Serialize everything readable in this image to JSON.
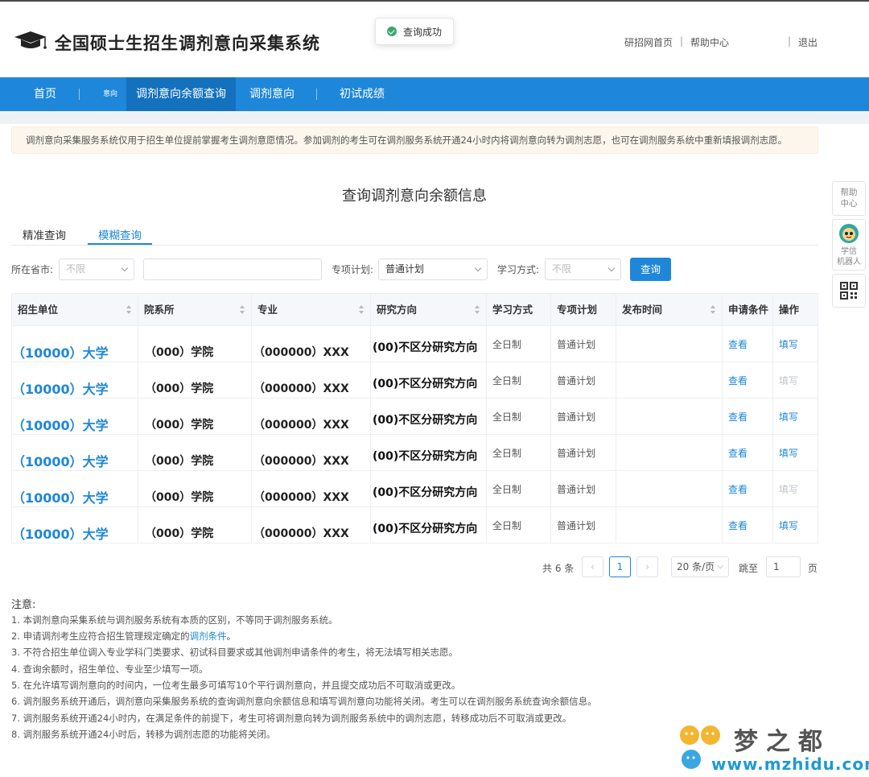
{
  "header": {
    "site_title": "全国硕士生招生调剂意向采集系统",
    "toast": "查询成功",
    "links": [
      "研招网首页",
      "帮助中心",
      "退出"
    ]
  },
  "nav": {
    "items": [
      "首页",
      "调剂意向余额查询",
      "调剂意向",
      "初试成绩"
    ],
    "small_label": "意向"
  },
  "notice": "调剂意向采集服务系统仅用于招生单位提前掌握考生调剂意愿情况。参加调剂的考生可在调剂服务系统开通24小时内将调剂意向转为调剂志愿，也可在调剂服务系统中重新填报调剂志愿。",
  "section_title": "查询调剂意向余额信息",
  "side": {
    "help": "帮助\n中心",
    "robot": "学信\n机器人"
  },
  "tabs": [
    "精准查询",
    "模糊查询"
  ],
  "filters": {
    "province_label": "所在省市:",
    "province_value": "不限",
    "plan_label": "专项计划:",
    "plan_value": "普通计划",
    "mode_label": "学习方式:",
    "mode_value": "不限",
    "query_button": "查询"
  },
  "table": {
    "columns": [
      "招生单位",
      "院系所",
      "专业",
      "研究方向",
      "学习方式",
      "专项计划",
      "发布时间",
      "申请条件",
      "操作"
    ],
    "rows": [
      {
        "unit": "（10000）大学",
        "dept": "（000）学院",
        "major": "（000000）XXX",
        "direction": "(00)不区分研究方向",
        "mode": "全日制",
        "plan": "普通计划",
        "time": "",
        "cond": "查看",
        "op": "填写",
        "op_enabled": true
      },
      {
        "unit": "（10000）大学",
        "dept": "（000）学院",
        "major": "（000000）XXX",
        "direction": "(00)不区分研究方向",
        "mode": "全日制",
        "plan": "普通计划",
        "time": "",
        "cond": "查看",
        "op": "填写",
        "op_enabled": false
      },
      {
        "unit": "（10000）大学",
        "dept": "（000）学院",
        "major": "（000000）XXX",
        "direction": "(00)不区分研究方向",
        "mode": "全日制",
        "plan": "普通计划",
        "time": "",
        "cond": "查看",
        "op": "填写",
        "op_enabled": true
      },
      {
        "unit": "（10000）大学",
        "dept": "（000）学院",
        "major": "（000000）XXX",
        "direction": "(00)不区分研究方向",
        "mode": "全日制",
        "plan": "普通计划",
        "time": "",
        "cond": "查看",
        "op": "填写",
        "op_enabled": true
      },
      {
        "unit": "（10000）大学",
        "dept": "（000）学院",
        "major": "（000000）XXX",
        "direction": "(00)不区分研究方向",
        "mode": "全日制",
        "plan": "普通计划",
        "time": "",
        "cond": "查看",
        "op": "填写",
        "op_enabled": false
      },
      {
        "unit": "（10000）大学",
        "dept": "（000）学院",
        "major": "（000000）XXX",
        "direction": "(00)不区分研究方向",
        "mode": "全日制",
        "plan": "普通计划",
        "time": "",
        "cond": "查看",
        "op": "填写",
        "op_enabled": true
      }
    ]
  },
  "pagination": {
    "total": "共 6 条",
    "current_page": "1",
    "page_size": "20 条/页",
    "jump_label": "跳至",
    "jump_value": "1",
    "page_suffix": "页"
  },
  "notes": {
    "title": "注意:",
    "items": [
      "1. 本调剂意向采集系统与调剂服务系统有本质的区别，不等同于调剂服务系统。",
      "2. 申请调剂考生应符合招生管理规定确定的",
      "3. 不符合招生单位调入专业学科门类要求、初试科目要求或其他调剂申请条件的考生，将无法填写相关志愿。",
      "4. 查询余额时，招生单位、专业至少填写一项。",
      "5. 在允许填写调剂意向的时间内，一位考生最多可填写10个平行调剂意向，并且提交成功后不可取消或更改。",
      "6. 调剂服务系统开通后，调剂意向采集服务系统的查询调剂意向余额信息和填写调剂意向功能将关闭。考生可以在调剂服务系统查询余额信息。",
      "7. 调剂服务系统开通24小时内，在满足条件的前提下，考生可将调剂意向转为调剂服务系统中的调剂志愿，转移成功后不可取消或更改。",
      "8. 调剂服务系统开通24小时后，转移为调剂志愿的功能将关闭。"
    ],
    "note2_link": "调剂条件",
    "note2_tail": "。"
  },
  "watermark": {
    "title": "梦之都",
    "url": "www.mzhidu.com"
  },
  "colors": {
    "brand_blue": "#1e87d9",
    "nav_active": "#1371bd",
    "success_green": "#3aa76d"
  }
}
